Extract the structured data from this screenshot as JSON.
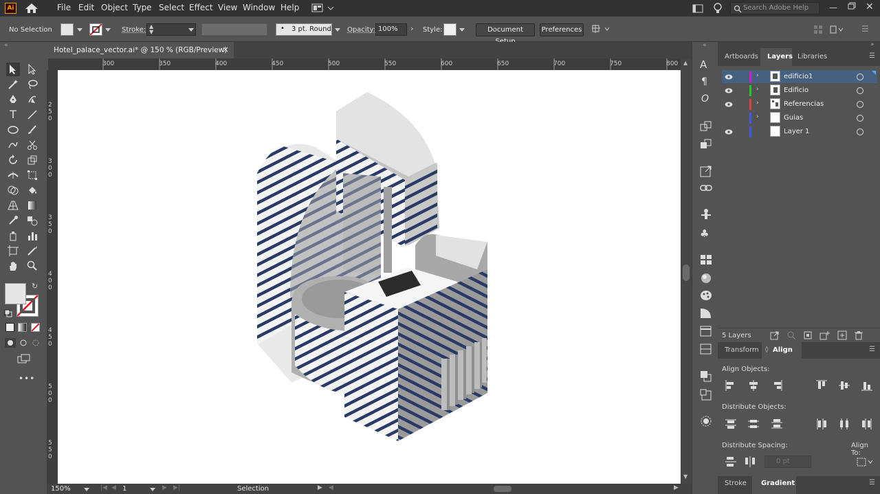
{
  "app": {
    "logo_text": "Ai"
  },
  "menu": [
    "File",
    "Edit",
    "Object",
    "Type",
    "Select",
    "Effect",
    "View",
    "Window",
    "Help"
  ],
  "search": {
    "placeholder": "Search Adobe Help"
  },
  "control_bar": {
    "selection_label": "No Selection",
    "stroke_label": "Stroke:",
    "brush_value": "3 pt. Round",
    "opacity_label": "Opacity:",
    "opacity_value": "100%",
    "style_label": "Style:",
    "document_setup": "Document Setup",
    "preferences": "Preferences"
  },
  "document": {
    "tab_title": "Hotel_palace_vector.ai* @ 150 % (RGB/Preview)",
    "close": "×"
  },
  "ruler": {
    "h_labels": [
      "300",
      "350",
      "400",
      "450",
      "500",
      "550",
      "600",
      "650",
      "700",
      "750",
      "800"
    ],
    "v_labels": [
      "250",
      "300",
      "350",
      "400",
      "450",
      "500",
      "550"
    ]
  },
  "status": {
    "zoom": "150%",
    "artboard": "1",
    "tool": "Selection"
  },
  "panels": {
    "top_tabs": [
      "Artboards",
      "Layers",
      "Libraries"
    ],
    "active_top_tab": "Layers",
    "layers": [
      {
        "name": "edificio1",
        "color": "#d21ec8",
        "visible": true,
        "selected": true
      },
      {
        "name": "Edificio",
        "color": "#23c828",
        "visible": true,
        "selected": false
      },
      {
        "name": "Referencias",
        "color": "#e04040",
        "visible": true,
        "selected": false
      },
      {
        "name": "Guias",
        "color": "#3c5ae6",
        "visible": false,
        "selected": false
      },
      {
        "name": "Layer 1",
        "color": "#3c5ae6",
        "visible": true,
        "selected": false
      }
    ],
    "layers_count": "5 Layers",
    "mid_tabs": [
      "Transform",
      "Align"
    ],
    "align_objects_label": "Align Objects:",
    "distribute_objects_label": "Distribute Objects:",
    "distribute_spacing_label": "Distribute Spacing:",
    "align_to_label": "Align To:",
    "spacing_value": "0 pt",
    "bottom_tabs": [
      "Stroke",
      "Gradient"
    ]
  },
  "colors": {
    "accent_selected_row": "#46607f",
    "stripe": "#283a66"
  }
}
